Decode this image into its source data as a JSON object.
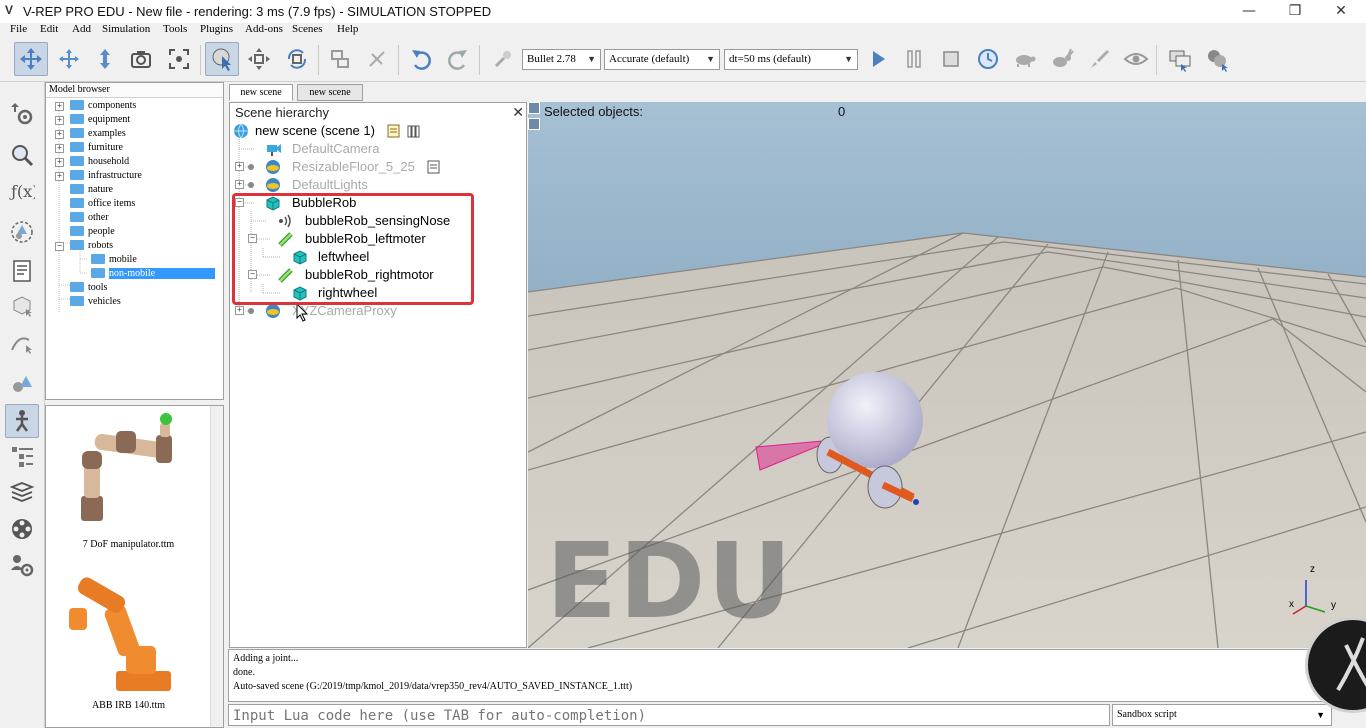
{
  "window": {
    "title": "V-REP PRO EDU - New file - rendering: 3 ms (7.9 fps) - SIMULATION STOPPED",
    "minimize": "—",
    "maximize": "❐",
    "close": "✕"
  },
  "menu": [
    "File",
    "Edit",
    "Add",
    "Simulation",
    "Tools",
    "Plugins",
    "Add-ons",
    "Scenes",
    "Help"
  ],
  "toolbar": {
    "engine": "Bullet 2.78",
    "accuracy": "Accurate (default)",
    "timestep": "dt=50 ms (default)",
    "dropdown_arrow": "▼"
  },
  "model_browser": {
    "header": "Model browser",
    "items": [
      "components",
      "equipment",
      "examples",
      "furniture",
      "household",
      "infrastructure",
      "nature",
      "office items",
      "other",
      "people",
      "robots",
      "mobile",
      "non-mobile",
      "tools",
      "vehicles"
    ],
    "thumbnails": [
      "7 DoF manipulator.ttm",
      "ABB IRB 140.ttm"
    ]
  },
  "scene_tabs": [
    "new scene",
    "new scene"
  ],
  "hierarchy": {
    "title": "Scene hierarchy",
    "close": "✕",
    "nodes": [
      "new scene (scene 1)",
      "DefaultCamera",
      "ResizableFloor_5_25",
      "DefaultLights",
      "BubbleRob",
      "bubbleRob_sensingNose",
      "bubbleRob_leftmoter",
      "leftwheel",
      "bubbleRob_rightmotor",
      "rightwheel",
      "XYZCameraProxy"
    ]
  },
  "viewport": {
    "info_label": "Selected objects:",
    "info_value": "0",
    "watermark": "EDU",
    "axes": [
      "z",
      "x",
      "y"
    ]
  },
  "console": {
    "lines": [
      "Adding a joint...",
      "done.",
      "Auto-saved scene (G:/2019/tmp/kmol_2019/data/vrep350_rev4/AUTO_SAVED_INSTANCE_1.ttt)"
    ]
  },
  "lua_input": {
    "placeholder": "Input Lua code here (use TAB for auto-completion)"
  },
  "script_selector": {
    "value": "Sandbox script",
    "arrow": "▼"
  },
  "colors": {
    "highlight": "#e0303a",
    "selection": "#3399ff",
    "cube_cyan": "#23c2c2",
    "sensor_magenta": "#e0208c"
  }
}
